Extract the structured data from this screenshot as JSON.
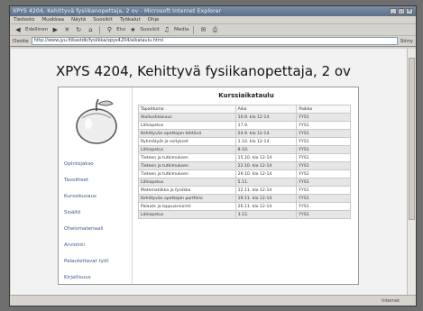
{
  "window": {
    "title": "XPYS 4204, Kehittyvä fysiikanopettaja, 2 ov - Microsoft Internet Explorer",
    "controls": [
      "_",
      "□",
      "×"
    ]
  },
  "menu": [
    "Tiedosto",
    "Muokkaa",
    "Näytä",
    "Suosikit",
    "Työkalut",
    "Ohje"
  ],
  "toolbar": {
    "back_label": "Edellinen",
    "search_label": "Etsi",
    "favorites_label": "Suosikit",
    "media_label": "Media"
  },
  "address": {
    "label": "Osoite",
    "url": "http://www.jyu.fi/kastdk/fysiikka/xpys4204/aikataulu.html",
    "go_label": "Siirry"
  },
  "page": {
    "title": "XPYS 4204, Kehittyvä fysiikanopettaja, 2 ov"
  },
  "sidebar": {
    "links": [
      "Opintojakso",
      "Tavoitteet",
      "Kurssikuvaus",
      "Sisältö",
      "Oheismateriaali",
      "Arviointi",
      "Palautettavat työt",
      "Kirjallisuus"
    ]
  },
  "schedule": {
    "title": "Kurssiaikataulu",
    "headers": [
      "Tapahtuma",
      "Aika",
      "Paikka"
    ],
    "rows": [
      [
        "Aloitustilaisuus",
        "10.9. klo 12-14",
        "FYS1"
      ],
      [
        "Lähiopetus",
        "17.9.",
        "FYS1"
      ],
      [
        "Kehittyvän opettajan tehtävä",
        "24.9. klo 12-14",
        "FYS1"
      ],
      [
        "Ryhmätyöt ja esitykset",
        "1.10. klo 12-14",
        "FYS1"
      ],
      [
        "Lähiopetus",
        "8.10.",
        "FYS1"
      ],
      [
        "Tieteen ja tutkimuksen",
        "15.10. klo 12-14",
        "FYS1"
      ],
      [
        "Tieteen ja tutkimuksen",
        "22.10. klo 12-14",
        "FYS1"
      ],
      [
        "Tieteen ja tutkimuksen",
        "29.10. klo 12-14",
        "FYS1"
      ],
      [
        "Lähiopetus",
        "5.11.",
        "FYS1"
      ],
      [
        "Matematiikka ja fysiikka",
        "12.11. klo 12-14",
        "FYS1"
      ],
      [
        "Kehittyvän opettajan portfolio",
        "19.11. klo 12-14",
        "FYS1"
      ],
      [
        "Palaute ja loppuarviointi",
        "26.11. klo 12-14",
        "FYS1"
      ],
      [
        "Lähiopetus",
        "3.12.",
        "FYS1"
      ]
    ]
  },
  "status": {
    "zone": "Internet"
  }
}
